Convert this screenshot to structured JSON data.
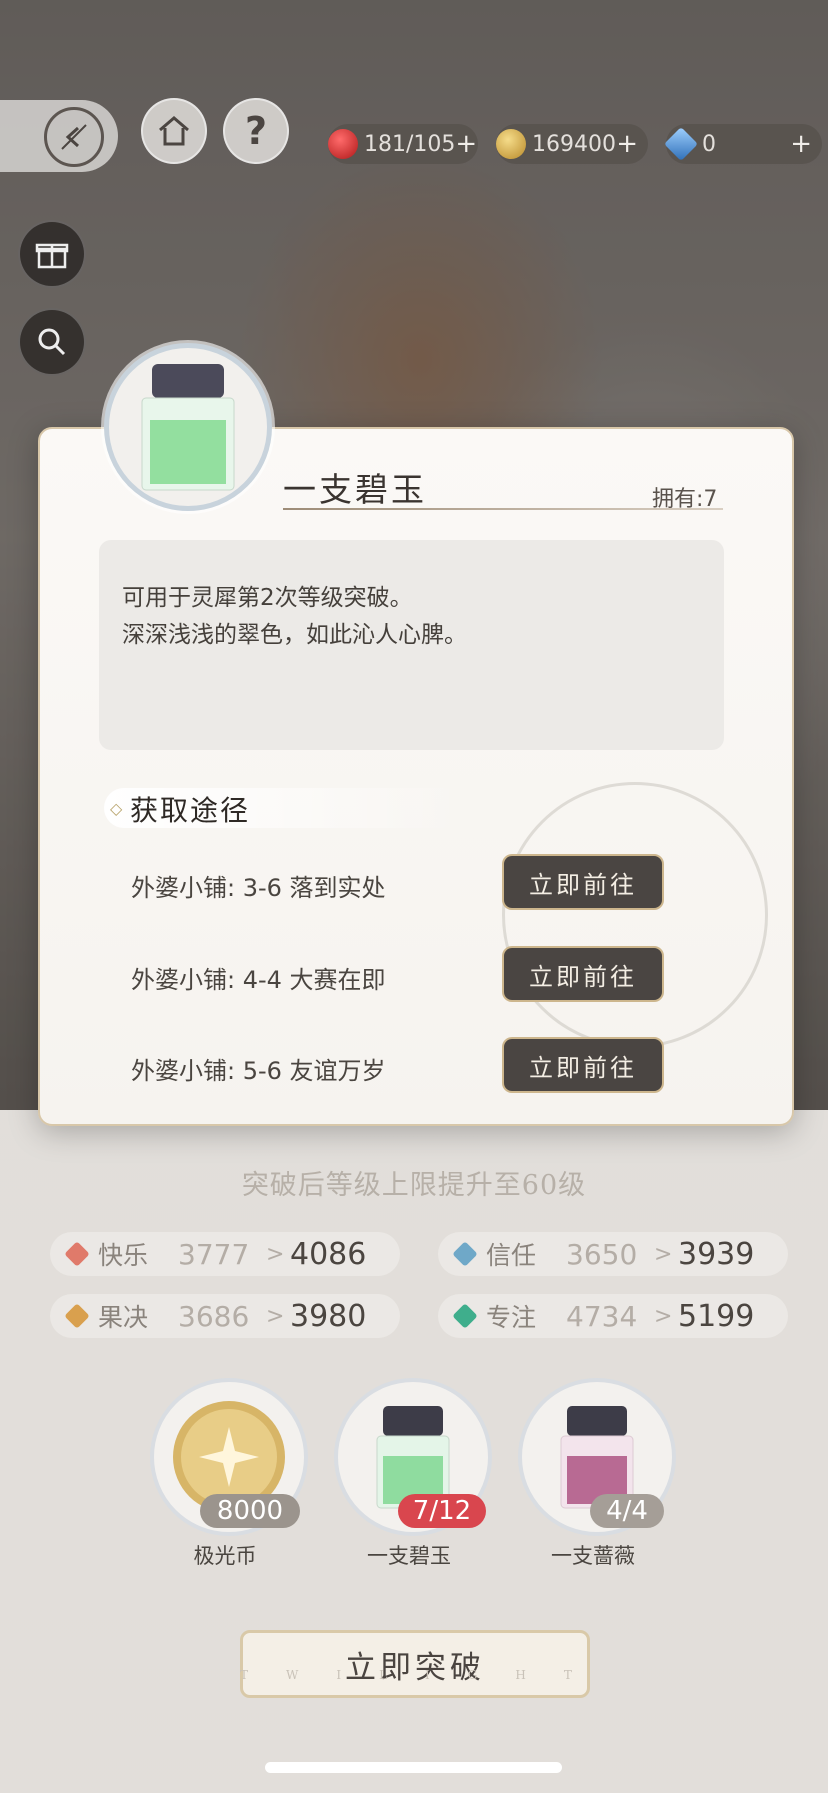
{
  "topbar": {
    "stamina": "181/105",
    "coins": "169400",
    "diamonds": "0",
    "plus": "+"
  },
  "item": {
    "name": "一支碧玉",
    "owned": "拥有:7",
    "desc_line1": "可用于灵犀第2次等级突破。",
    "desc_line2": "深深浅浅的翠色，如此沁人心脾。"
  },
  "routes": {
    "title": "获取途径",
    "items": [
      {
        "text": "外婆小铺: 3-6 落到实处",
        "button": "立即前往"
      },
      {
        "text": "外婆小铺: 4-4 大赛在即",
        "button": "立即前往"
      },
      {
        "text": "外婆小铺: 5-6 友谊万岁",
        "button": "立即前往"
      }
    ]
  },
  "breakthrough": {
    "info": "突破后等级上限提升至60级",
    "stats": [
      {
        "name": "快乐",
        "from": "3777",
        "to": "4086",
        "arrow": ">",
        "color": "#e07a6a"
      },
      {
        "name": "信任",
        "from": "3650",
        "to": "3939",
        "arrow": ">",
        "color": "#6fa8c8"
      },
      {
        "name": "果决",
        "from": "3686",
        "to": "3980",
        "arrow": ">",
        "color": "#d9a04e"
      },
      {
        "name": "专注",
        "from": "4734",
        "to": "5199",
        "arrow": ">",
        "color": "#3fae8c"
      }
    ],
    "materials": [
      {
        "name": "极光币",
        "count": "8000",
        "badge_color": "#9b948d"
      },
      {
        "name": "一支碧玉",
        "count": "7/12",
        "badge_color": "#d9464e"
      },
      {
        "name": "一支蔷薇",
        "count": "4/4",
        "badge_color": "#a59e97"
      }
    ],
    "button": "立即突破",
    "watermark": "TWILIGHT"
  }
}
